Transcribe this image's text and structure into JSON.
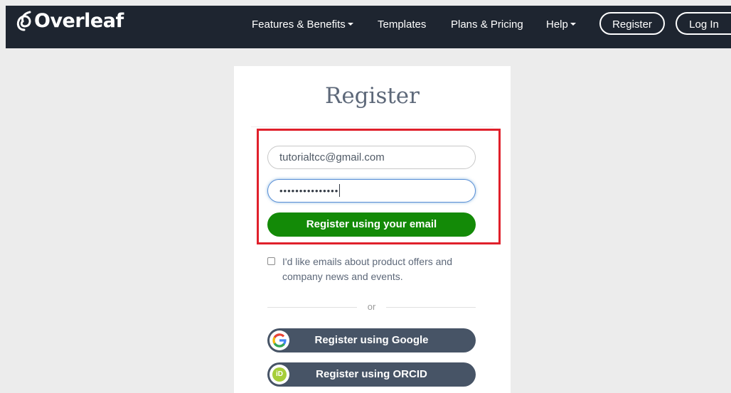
{
  "nav": {
    "logo": "Overleaf",
    "items": [
      {
        "label": "Features & Benefits",
        "dropdown": true
      },
      {
        "label": "Templates",
        "dropdown": false
      },
      {
        "label": "Plans & Pricing",
        "dropdown": false
      },
      {
        "label": "Help",
        "dropdown": true
      }
    ],
    "register": "Register",
    "login": "Log In"
  },
  "form": {
    "title": "Register",
    "email_value": "tutorialtcc@gmail.com",
    "password_value": "•••••••••••••••",
    "submit_label": "Register using your email",
    "consent_text": "I'd like emails about product offers and company news and events.",
    "or_label": "or",
    "google_label": "Register using Google",
    "orcid_label": "Register using ORCID",
    "orcid_icon_text": "iD"
  },
  "colors": {
    "navbar": "#1e2530",
    "primary": "#138a07",
    "provider": "#475466",
    "highlight": "#e0202b"
  }
}
